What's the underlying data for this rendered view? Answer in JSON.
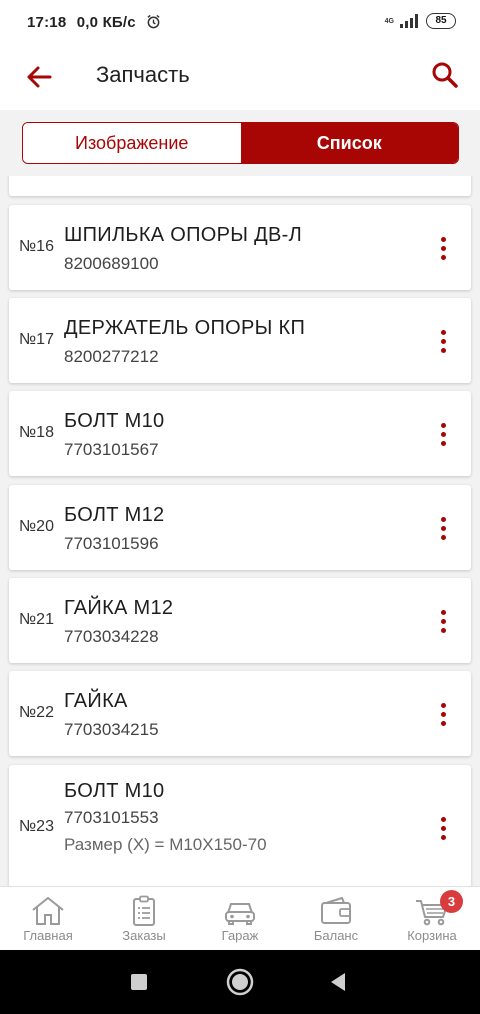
{
  "status": {
    "time": "17:18",
    "speed": "0,0 КБ/с",
    "network": "4G",
    "battery": "85"
  },
  "appbar": {
    "title": "Запчасть"
  },
  "tabs": [
    {
      "label": "Изображение",
      "active": false
    },
    {
      "label": "Список",
      "active": true
    }
  ],
  "parts": [
    {
      "num": "№16",
      "name": "ШПИЛЬКА ОПОРЫ ДВ-Л",
      "code": "8200689100"
    },
    {
      "num": "№17",
      "name": "ДЕРЖАТЕЛЬ ОПОРЫ КП",
      "code": "8200277212"
    },
    {
      "num": "№18",
      "name": "БОЛТ М10",
      "code": "7703101567"
    },
    {
      "num": "№20",
      "name": "БОЛТ М12",
      "code": "7703101596"
    },
    {
      "num": "№21",
      "name": "ГАЙКА М12",
      "code": "7703034228"
    },
    {
      "num": "№22",
      "name": "ГАЙКА",
      "code": "7703034215"
    },
    {
      "num": "№23",
      "name": "БОЛТ М10",
      "code": "7703101553",
      "extra": "Размер (X) = M10X150-70"
    }
  ],
  "nav": {
    "items": [
      {
        "label": "Главная",
        "icon": "home-icon"
      },
      {
        "label": "Заказы",
        "icon": "orders-icon"
      },
      {
        "label": "Гараж",
        "icon": "car-icon"
      },
      {
        "label": "Баланс",
        "icon": "wallet-icon"
      },
      {
        "label": "Корзина",
        "icon": "cart-icon"
      }
    ],
    "cart_badge": "3"
  },
  "colors": {
    "accent": "#a80505",
    "badge": "#d83c3c"
  }
}
